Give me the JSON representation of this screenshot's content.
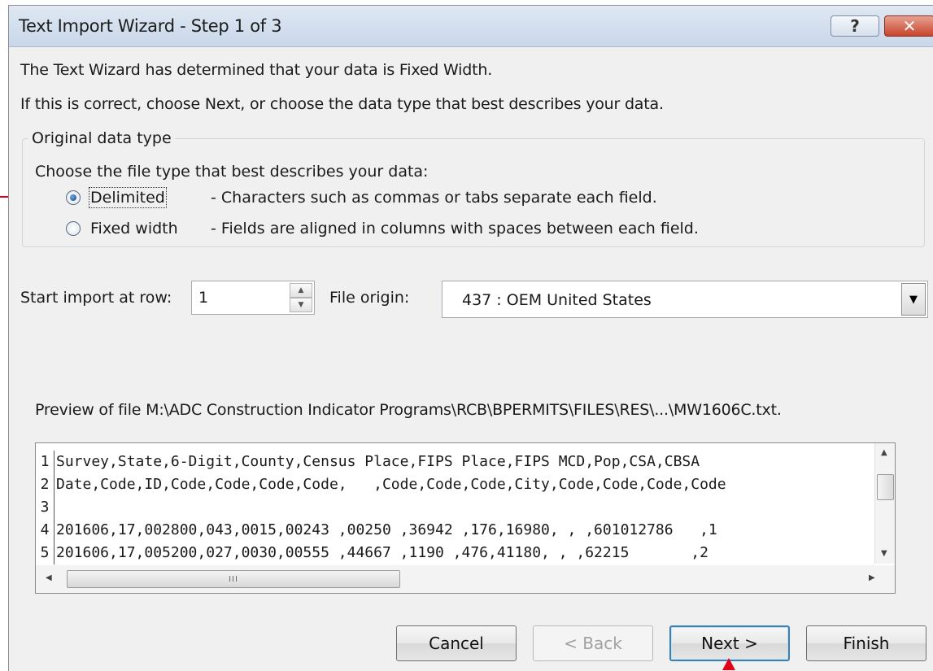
{
  "window": {
    "title": "Text Import Wizard - Step 1 of 3"
  },
  "titlebar_buttons": {
    "help": "?",
    "close": "✕"
  },
  "messages": {
    "line1": "The Text Wizard has determined that your data is Fixed Width.",
    "line2": "If this is correct, choose Next, or choose the data type that best describes your data."
  },
  "original_data_type": {
    "legend": "Original data type",
    "description": "Choose the file type that best describes your data:",
    "options": [
      {
        "label": "Delimited",
        "desc": "- Characters such as commas or tabs separate each field.",
        "selected": true
      },
      {
        "label": "Fixed width",
        "desc": "- Fields are aligned in columns with spaces between each field.",
        "selected": false
      }
    ]
  },
  "import_options": {
    "start_row_label": "Start import at row:",
    "start_row_value": "1",
    "file_origin_label": "File origin:",
    "file_origin_value": "437 : OEM United States"
  },
  "preview": {
    "label": "Preview of file M:\\ADC Construction Indicator Programs\\RCB\\BPERMITS\\FILES\\RES\\...\\MW1606C.txt.",
    "rows": [
      {
        "num": "1",
        "text": "Survey,State,6-Digit,County,Census Place,FIPS Place,FIPS MCD,Pop,CSA,CBSA"
      },
      {
        "num": "2",
        "text": "Date,Code,ID,Code,Code,Code,Code,   ,Code,Code,Code,City,Code,Code,Code,Code"
      },
      {
        "num": "3",
        "text": ""
      },
      {
        "num": "4",
        "text": "201606,17,002800,043,0015,00243 ,00250 ,36942 ,176,16980, , ,601012786   ,1"
      },
      {
        "num": "5",
        "text": "201606,17,005200,027,0030,00555 ,44667 ,1190 ,476,41180, , ,62215       ,2"
      }
    ],
    "hscroll_grip": "III"
  },
  "buttons": {
    "cancel": "Cancel",
    "back": "< Back",
    "next": "Next >",
    "finish": "Finish"
  },
  "colors": {
    "annotation_arrow": "#e0001b",
    "default_button_border": "#3c7fb1"
  }
}
